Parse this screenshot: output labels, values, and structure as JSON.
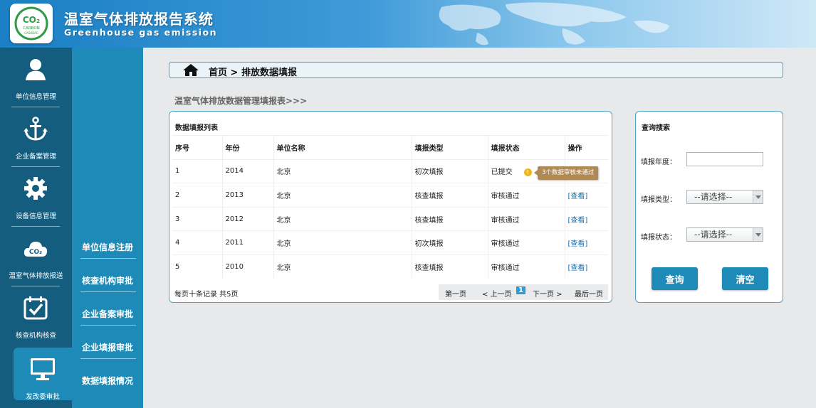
{
  "header": {
    "title": "温室气体排放报告系统",
    "subtitle": "Greenhouse gas emission",
    "logo": {
      "main": "CO₂",
      "sub": "CARBON",
      "sub2": "CASHBAG"
    }
  },
  "leftnav": [
    {
      "label": "单位信息管理",
      "icon": "user-icon"
    },
    {
      "label": "企业备案管理",
      "icon": "anchor-icon"
    },
    {
      "label": "设备信息管理",
      "icon": "gear-icon"
    },
    {
      "label": "温室气体排放报送",
      "icon": "co2-cloud-icon"
    },
    {
      "label": "核查机构核查",
      "icon": "calendar-check-icon"
    },
    {
      "label": "发改委审批",
      "icon": "monitor-icon",
      "active": true
    }
  ],
  "subnav": [
    "单位信息注册",
    "核查机构审批",
    "企业备案审批",
    "企业填报审批",
    "数据填报情况"
  ],
  "breadcrumb": "首页 > 排放数据填报",
  "section_title": "温室气体排放数据管理填报表>>>",
  "list": {
    "title": "数据填报列表",
    "columns": [
      "序号",
      "年份",
      "单位名称",
      "填报类型",
      "填报状态",
      "操作"
    ],
    "rows": [
      {
        "no": "1",
        "year": "2014",
        "unit": "北京",
        "type": "初次填报",
        "status": "已提交",
        "action": ""
      },
      {
        "no": "2",
        "year": "2013",
        "unit": "北京",
        "type": "核查填报",
        "status": "审核通过",
        "action": "[查看]"
      },
      {
        "no": "3",
        "year": "2012",
        "unit": "北京",
        "type": "核查填报",
        "status": "审核通过",
        "action": "[查看]"
      },
      {
        "no": "4",
        "year": "2011",
        "unit": "北京",
        "type": "初次填报",
        "status": "审核通过",
        "action": "[查看]"
      },
      {
        "no": "5",
        "year": "2010",
        "unit": "北京",
        "type": "核查填报",
        "status": "审核通过",
        "action": "[查看]"
      }
    ],
    "tooltip": "3个数据审核未通过",
    "footer_info": "每页十条记录  共5页",
    "pager": {
      "first": "第一页",
      "prev": "< 上一页",
      "current": "1",
      "next": "下一页 >",
      "last": "最后一页"
    }
  },
  "search": {
    "title": "查询搜索",
    "year_label": "填报年度：",
    "year_value": "",
    "type_label": "填报类型：",
    "type_value": "--请选择--",
    "status_label": "填报状态：",
    "status_value": "--请选择--",
    "query_button": "查询",
    "clear_button": "清空"
  }
}
